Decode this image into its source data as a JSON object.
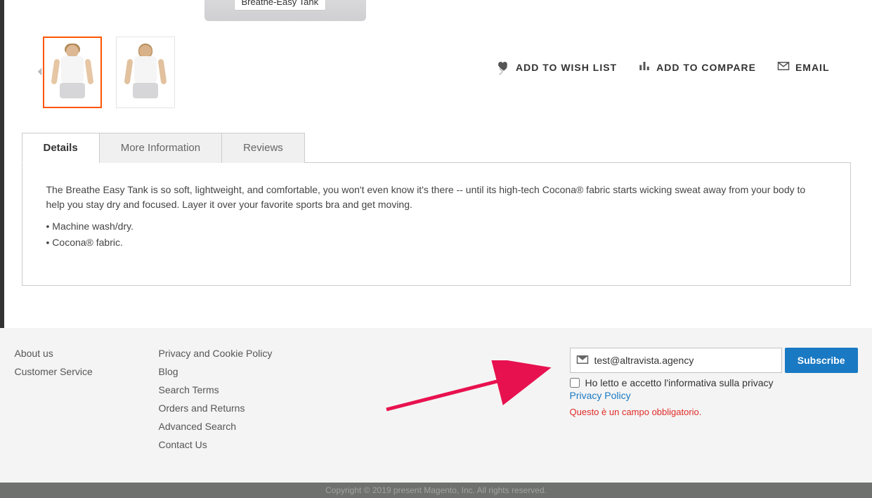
{
  "product": {
    "title_tooltip": "Breathe-Easy Tank"
  },
  "social": {
    "wishlist": "ADD TO WISH LIST",
    "compare": "ADD TO COMPARE",
    "email": "EMAIL"
  },
  "tabs": {
    "details": "Details",
    "more_info": "More Information",
    "reviews": "Reviews"
  },
  "description": {
    "para": "The Breathe Easy Tank is so soft, lightweight, and comfortable, you won't even know it's there -- until its high-tech Cocona® fabric starts wicking sweat away from your body to help you stay dry and focused. Layer it over your favorite sports bra and get moving.",
    "bullet1": "• Machine wash/dry.",
    "bullet2": "• Cocona® fabric."
  },
  "footer": {
    "col1": {
      "about": "About us",
      "customer_service": "Customer Service"
    },
    "col2": {
      "privacy_cookie": "Privacy and Cookie Policy",
      "blog": "Blog",
      "search_terms": "Search Terms",
      "orders_returns": "Orders and Returns",
      "advanced_search": "Advanced Search",
      "contact": "Contact Us"
    }
  },
  "newsletter": {
    "email_value": "test@altravista.agency",
    "subscribe": "Subscribe",
    "consent_label": "Ho letto e accetto l'informativa sulla privacy",
    "privacy_link": "Privacy Policy",
    "error": "Questo è un campo obbligatorio."
  },
  "copyright": "Copyright © 2019 present Magento, Inc. All rights reserved."
}
